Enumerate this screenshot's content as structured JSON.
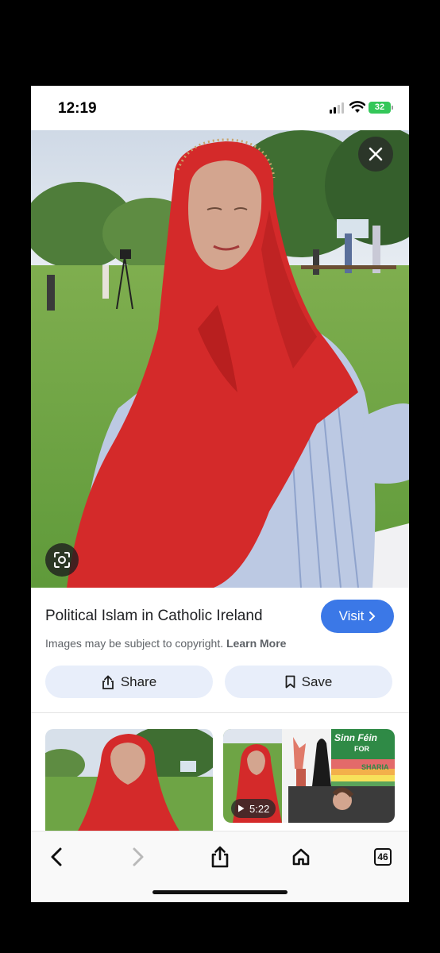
{
  "status_bar": {
    "time": "12:19",
    "battery": "32"
  },
  "hero": {
    "close_icon": "close-icon",
    "lens_icon": "lens-icon"
  },
  "result": {
    "title": "Political Islam in Catholic Ireland",
    "visit_label": "Visit",
    "copyright_text": "Images may be subject to copyright.",
    "learn_more": "Learn More",
    "share_label": "Share",
    "save_label": "Save"
  },
  "related": [
    {
      "type": "image"
    },
    {
      "type": "video",
      "duration": "5:22",
      "banner_text": "Sinn Féin",
      "sign_for": "FOR",
      "sign_sharia": "SHARIA"
    }
  ],
  "toolbar": {
    "back_icon": "chevron-left-icon",
    "forward_icon": "chevron-right-icon",
    "share_icon": "share-icon",
    "home_icon": "home-icon",
    "tabs_count": "46"
  },
  "colors": {
    "accent": "#3b78e7",
    "pill_bg": "#e8eefa",
    "battery": "#34c759",
    "scarf": "#d42a2a"
  }
}
